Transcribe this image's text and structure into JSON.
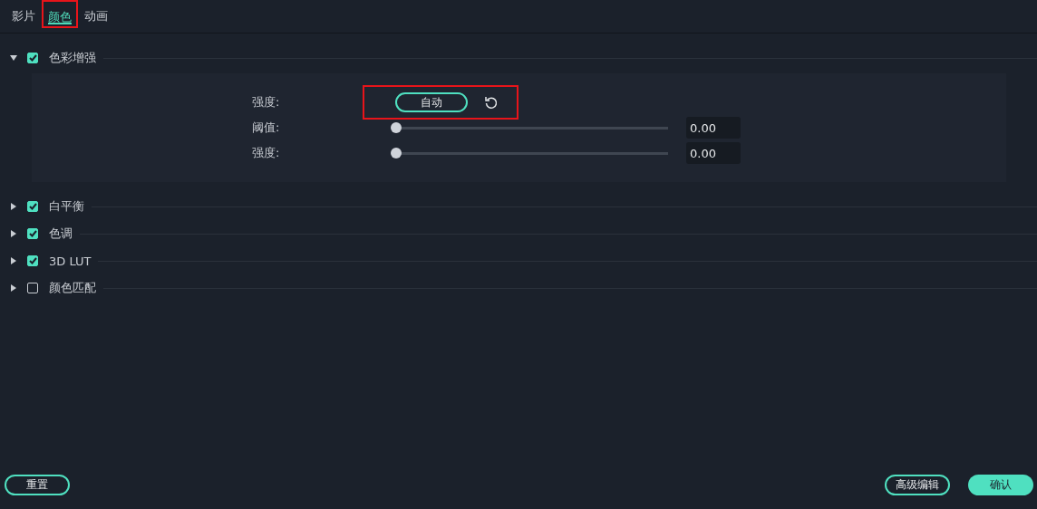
{
  "tabs": [
    {
      "label": "影片",
      "selected": false,
      "highlighted": false
    },
    {
      "label": "颜色",
      "selected": true,
      "highlighted": true
    },
    {
      "label": "动画",
      "selected": false,
      "highlighted": false
    }
  ],
  "sections": [
    {
      "title": "色彩增强",
      "checked": true,
      "expanded": true,
      "controls": [
        {
          "kind": "auto",
          "label": "强度:",
          "button": "自动",
          "highlighted": true
        },
        {
          "kind": "slider",
          "label": "阈值:",
          "level": 0,
          "value": "0.00"
        },
        {
          "kind": "slider",
          "label": "强度:",
          "level": 0,
          "value": "0.00"
        }
      ]
    },
    {
      "title": "白平衡",
      "checked": true,
      "expanded": false
    },
    {
      "title": "色调",
      "checked": true,
      "expanded": false
    },
    {
      "title": "3D LUT",
      "checked": true,
      "expanded": false
    },
    {
      "title": "颜色匹配",
      "checked": false,
      "expanded": false
    }
  ],
  "footer": {
    "reset": "重置",
    "advanced": "高级编辑",
    "confirm": "确认"
  }
}
